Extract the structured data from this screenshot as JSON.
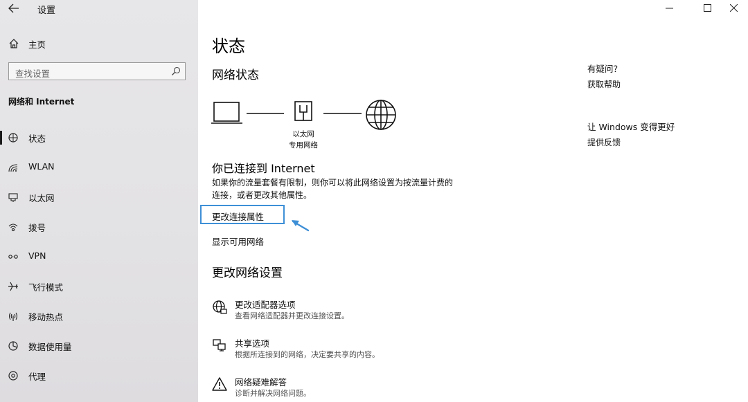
{
  "window": {
    "title": "设置"
  },
  "sidebar": {
    "home_label": "主页",
    "search_placeholder": "查找设置",
    "section_title": "网络和 Internet",
    "items": [
      {
        "label": "状态",
        "icon": "status-icon",
        "active": true
      },
      {
        "label": "WLAN",
        "icon": "wlan-icon"
      },
      {
        "label": "以太网",
        "icon": "ethernet-icon"
      },
      {
        "label": "拨号",
        "icon": "dialup-icon"
      },
      {
        "label": "VPN",
        "icon": "vpn-icon"
      },
      {
        "label": "飞行模式",
        "icon": "airplane-icon"
      },
      {
        "label": "移动热点",
        "icon": "hotspot-icon"
      },
      {
        "label": "数据使用量",
        "icon": "data-usage-icon"
      },
      {
        "label": "代理",
        "icon": "proxy-icon"
      }
    ]
  },
  "main": {
    "title": "状态",
    "network_status_heading": "网络状态",
    "diagram": {
      "adapter_name": "以太网",
      "network_type": "专用网络"
    },
    "connected_heading": "你已连接到 Internet",
    "connected_desc_line1": "如果你的流量套餐有限制，则你可以将此网络设置为按流量计费的",
    "connected_desc_line2": "连接，或者更改其他属性。",
    "change_properties_link": "更改连接属性",
    "show_networks_link": "显示可用网络",
    "change_settings_heading": "更改网络设置",
    "options": [
      {
        "title": "更改适配器选项",
        "desc": "查看网络适配器并更改连接设置。",
        "icon": "adapter-icon"
      },
      {
        "title": "共享选项",
        "desc": "根据所连接到的网络，决定要共享的内容。",
        "icon": "sharing-icon"
      },
      {
        "title": "网络疑难解答",
        "desc": "诊断并解决网络问题。",
        "icon": "warning-icon"
      }
    ]
  },
  "right_panel": {
    "question_heading": "有疑问？",
    "get_help_link": "获取帮助",
    "improve_heading": "让 Windows 变得更好",
    "feedback_link": "提供反馈"
  },
  "colors": {
    "highlight_border": "#3d8fd6",
    "arrow": "#3d8fd6",
    "sidebar_bg": "#e4e3e5"
  }
}
